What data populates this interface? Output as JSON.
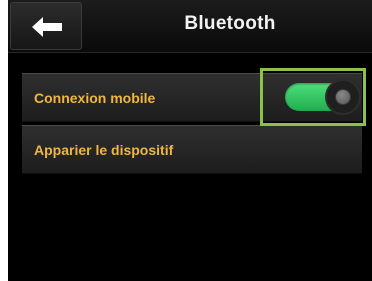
{
  "header": {
    "title": "Bluetooth",
    "back_icon": "left-arrow-icon"
  },
  "settings": [
    {
      "label": "Connexion mobile",
      "toggle_state": "on",
      "toggle_color": "#2ecc65"
    },
    {
      "label": "Apparier le dispositif"
    }
  ],
  "colors": {
    "label": "#f0b640",
    "highlight": "#8bc34a",
    "background": "#000000"
  }
}
